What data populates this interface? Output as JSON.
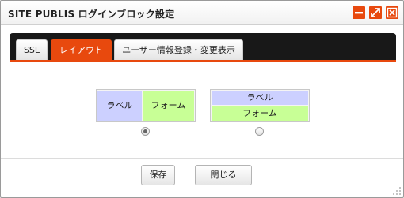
{
  "window": {
    "title": "SITE PUBLIS ログインブロック設定",
    "controls": {
      "minimize_icon": "minimize-icon",
      "maximize_icon": "maximize-icon",
      "close_icon": "close-icon"
    }
  },
  "tabs": [
    {
      "label": "SSL",
      "active": false
    },
    {
      "label": "レイアウト",
      "active": true
    },
    {
      "label": "ユーザー情報登録・変更表示",
      "active": false
    }
  ],
  "layout_options": [
    {
      "label_text": "ラベル",
      "form_text": "フォーム",
      "arrangement": "horizontal",
      "selected": true
    },
    {
      "label_text": "ラベル",
      "form_text": "フォーム",
      "arrangement": "vertical",
      "selected": false
    }
  ],
  "footer": {
    "save_label": "保存",
    "close_label": "閉じる"
  },
  "colors": {
    "accent": "#e8490e",
    "tabbar": "#181818",
    "label_cell": "#ccd0ff",
    "form_cell": "#c8ff96"
  }
}
